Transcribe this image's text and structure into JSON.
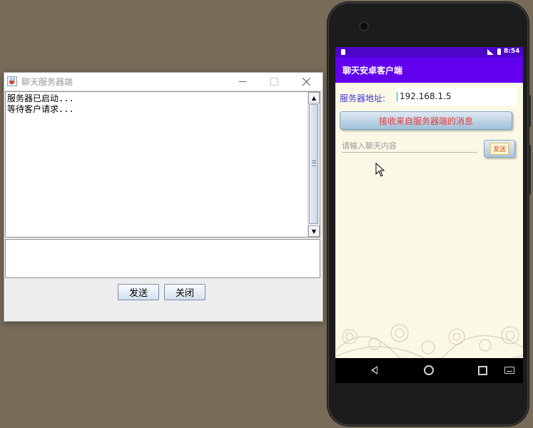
{
  "server_window": {
    "title": "聊天服务器端",
    "chat_log": "服务器已启动...\n等待客户请求...",
    "input_value": "",
    "buttons": {
      "send": "发送",
      "close": "关闭"
    }
  },
  "android_client": {
    "status_bar": {
      "time": "8:54"
    },
    "app_title": "聊天安卓客户端",
    "server_address_label": "服务器地址:",
    "server_address_value": "192.168.1.5",
    "receive_button": "接收来自服务器端的消息",
    "message_placeholder": "请输入聊天内容",
    "send_button": "发送",
    "colors": {
      "status_bar": "#4d05c9",
      "app_bar": "#6200ee",
      "background": "#fbf8e6"
    }
  }
}
